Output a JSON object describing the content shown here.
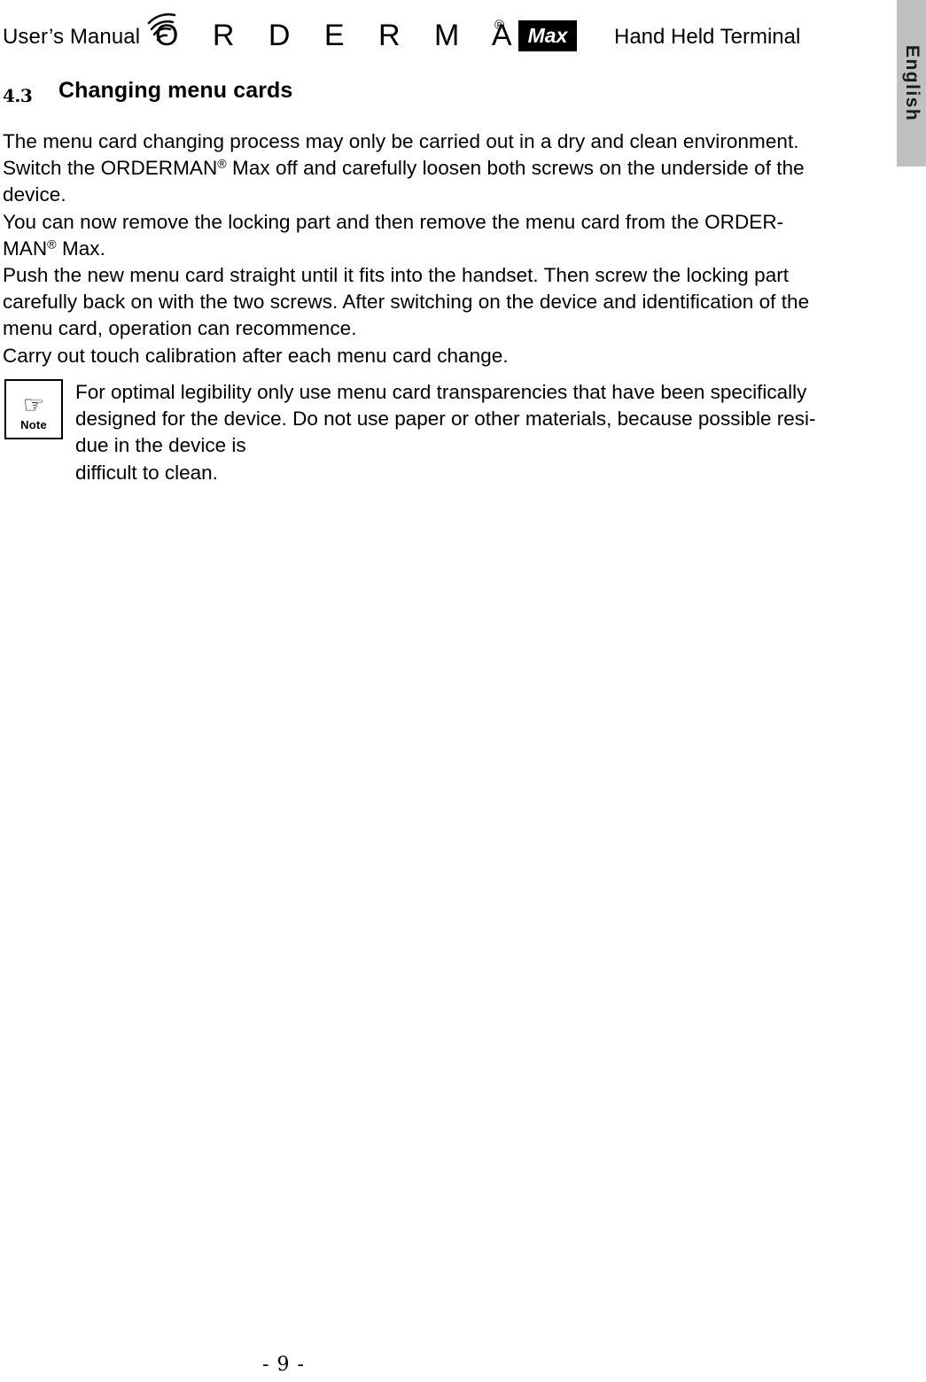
{
  "header": {
    "left_label": "User’s Manual",
    "right_label": "Hand Held Terminal",
    "brand": {
      "wordmark": "O R D E R M A N",
      "registered_symbol": "®",
      "badge_text": "Max",
      "waves_icon": "radio-waves-icon"
    }
  },
  "language_tab": {
    "label": "English",
    "background_color": "#c0c0c0"
  },
  "section": {
    "number": "4.3",
    "title": "Changing menu cards"
  },
  "body": {
    "lines": [
      "The menu card changing process may only be carried out in a dry and clean environment.",
      "Switch the ORDERMAN® Max off and carefully loosen both screws on the underside of the",
      "device.",
      "You can now remove the locking part and then remove the menu card from the ORDER-",
      "MAN® Max.",
      "Push the new menu card straight until it fits into the handset. Then screw the locking part",
      "carefully back on with the two screws. After switching on the device and identification of the",
      "menu card, operation can recommence.",
      "Carry out touch calibration after each menu card change."
    ]
  },
  "note": {
    "icon": "pointing-hand-icon",
    "icon_glyph": "☞",
    "label": "Note",
    "lines": [
      "For optimal legibility only use menu card transparencies that have been specifically",
      "designed for the device. Do not use paper or other materials, because possible resi-",
      "due in the device is",
      "difficult to clean."
    ]
  },
  "footer": {
    "page_number": "- 9 -"
  }
}
